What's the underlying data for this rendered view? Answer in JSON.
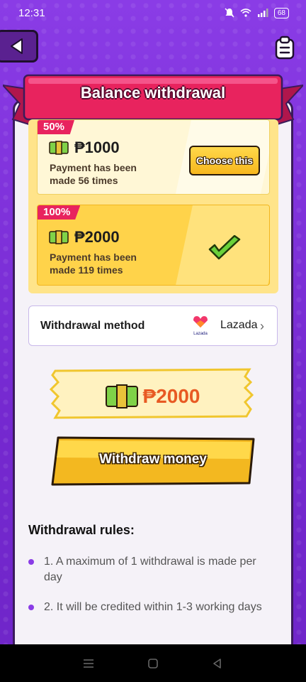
{
  "status": {
    "time": "12:31",
    "battery": "68"
  },
  "header": {
    "title": "Balance withdrawal"
  },
  "options": [
    {
      "percent": "50%",
      "amount": "₱1000",
      "desc": "Payment has been made 56 times",
      "action": "Choose this",
      "selected": false
    },
    {
      "percent": "100%",
      "amount": "₱2000",
      "desc": "Payment has been made 119 times",
      "selected": true
    }
  ],
  "method": {
    "label": "Withdrawal method",
    "provider_logo_text": "Lazada",
    "provider": "Lazada"
  },
  "summary": {
    "amount": "₱2000"
  },
  "withdraw_button": {
    "label": "Withdraw money"
  },
  "rules": {
    "title": "Withdrawal rules:",
    "items": [
      "1. A maximum of 1 withdrawal is made per day",
      "2. It will be credited within 1-3 working days"
    ]
  },
  "colors": {
    "accent": "#e8235e",
    "purple": "#7a2fd6",
    "amount": "#e85a23",
    "gold": "#ffd34a"
  }
}
